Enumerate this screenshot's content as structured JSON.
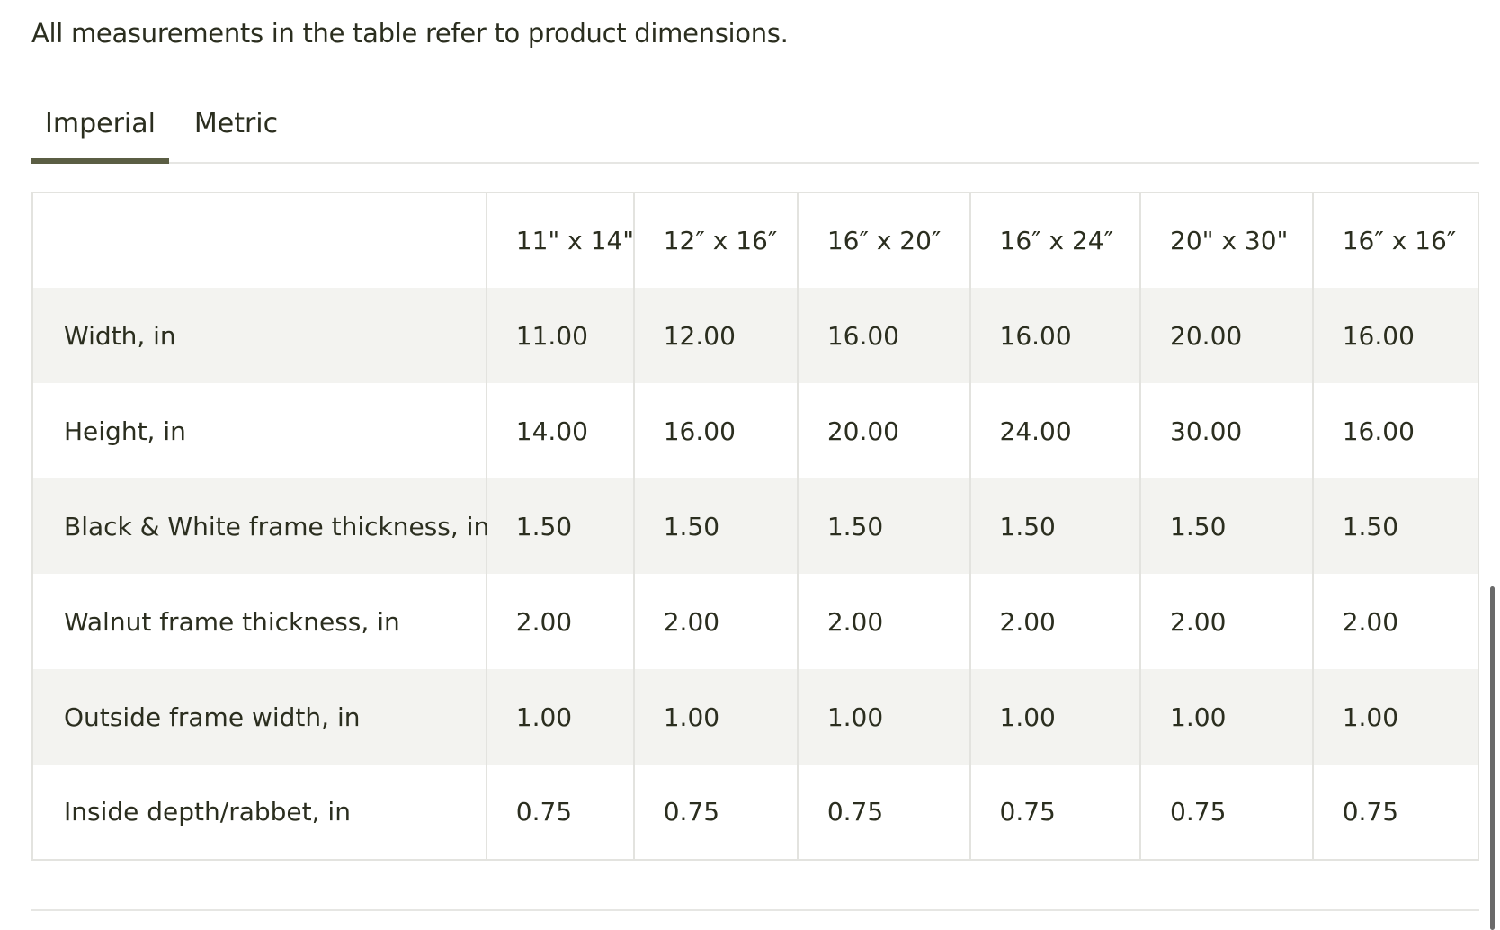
{
  "intro_text": "All measurements in the table refer to product dimensions.",
  "tabs": [
    {
      "label": "Imperial",
      "active": true
    },
    {
      "label": "Metric",
      "active": false
    }
  ],
  "table": {
    "columns": [
      "",
      "11\" x 14\"",
      "12″ x 16″",
      "16″ x 20″",
      "16″ x 24″",
      "20\" x 30\"",
      "16″ x 16″"
    ],
    "rows": [
      {
        "label": "Width, in",
        "values": [
          "11.00",
          "12.00",
          "16.00",
          "16.00",
          "20.00",
          "16.00"
        ]
      },
      {
        "label": "Height, in",
        "values": [
          "14.00",
          "16.00",
          "20.00",
          "24.00",
          "30.00",
          "16.00"
        ]
      },
      {
        "label": "Black & White frame thickness, in",
        "values": [
          "1.50",
          "1.50",
          "1.50",
          "1.50",
          "1.50",
          "1.50"
        ]
      },
      {
        "label": "Walnut frame thickness, in",
        "values": [
          "2.00",
          "2.00",
          "2.00",
          "2.00",
          "2.00",
          "2.00"
        ]
      },
      {
        "label": "Outside frame width, in",
        "values": [
          "1.00",
          "1.00",
          "1.00",
          "1.00",
          "1.00",
          "1.00"
        ]
      },
      {
        "label": "Inside depth/rabbet, in",
        "values": [
          "0.75",
          "0.75",
          "0.75",
          "0.75",
          "0.75",
          "0.75"
        ]
      }
    ]
  },
  "colors": {
    "text": "#2b2e1f",
    "tab_underline": "#5b5e44",
    "row_stripe": "#f3f3f0",
    "border": "#e3e3df"
  }
}
